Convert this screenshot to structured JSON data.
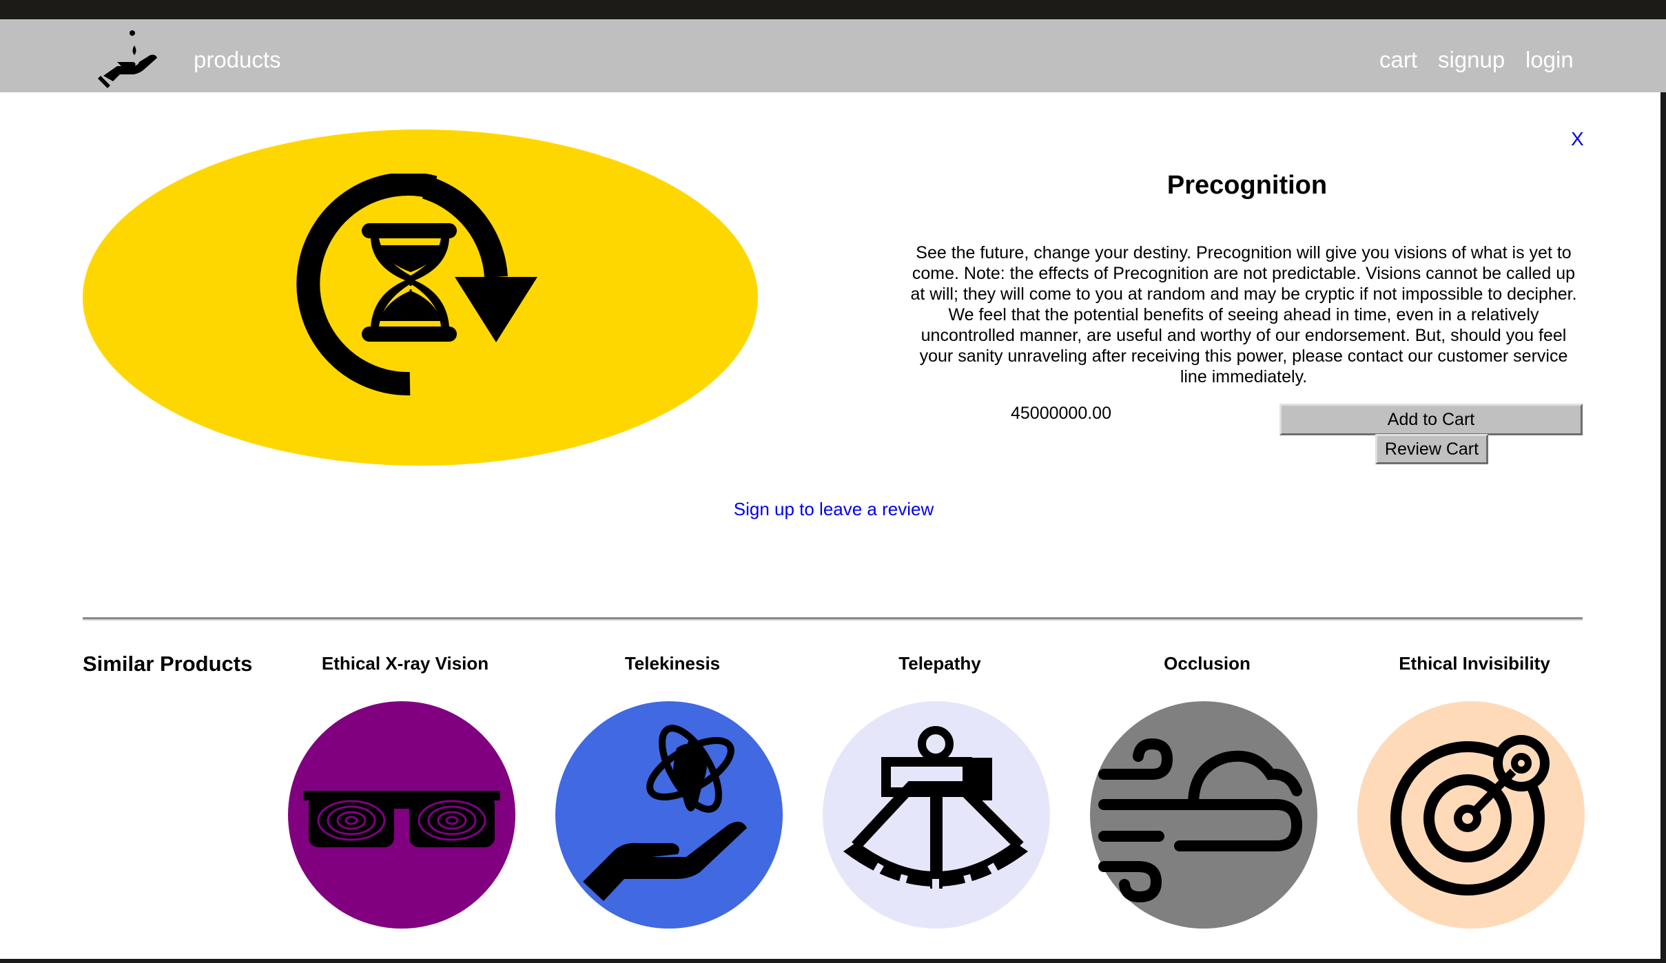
{
  "nav": {
    "logo_icon": "hand-receiving-drop-icon",
    "products_label": "products",
    "cart_label": "cart",
    "signup_label": "signup",
    "login_label": "login"
  },
  "product": {
    "close_label": "X",
    "title": "Precognition",
    "description": "See the future, change your destiny. Precognition will give you visions of what is yet to come. Note: the effects of Precognition are not predictable. Visions cannot be called up at will; they will come to you at random and may be cryptic if not impossible to decipher. We feel that the potential benefits of seeing ahead in time, even in a relatively uncontrolled manner, are useful and worthy of our endorsement. But, should you feel your sanity unraveling after receiving this power, please contact our customer service line immediately.",
    "price": "45000000.00",
    "add_to_cart_label": "Add to Cart",
    "review_cart_label": "Review Cart",
    "image_icon": "hourglass-rewind-icon",
    "image_bg": "#ffd700"
  },
  "review": {
    "link_label": "Sign up to leave a review"
  },
  "similar": {
    "heading": "Similar Products",
    "items": [
      {
        "name": "Ethical X-ray Vision",
        "icon": "xray-glasses-icon",
        "bg": "#800080"
      },
      {
        "name": "Telekinesis",
        "icon": "levitating-mind-icon",
        "bg": "#4169e1"
      },
      {
        "name": "Telepathy",
        "icon": "sextant-icon",
        "bg": "#e6e6fa"
      },
      {
        "name": "Occlusion",
        "icon": "wind-cloud-icon",
        "bg": "#808080"
      },
      {
        "name": "Ethical Invisibility",
        "icon": "radar-target-icon",
        "bg": "#ffdab9"
      }
    ]
  }
}
